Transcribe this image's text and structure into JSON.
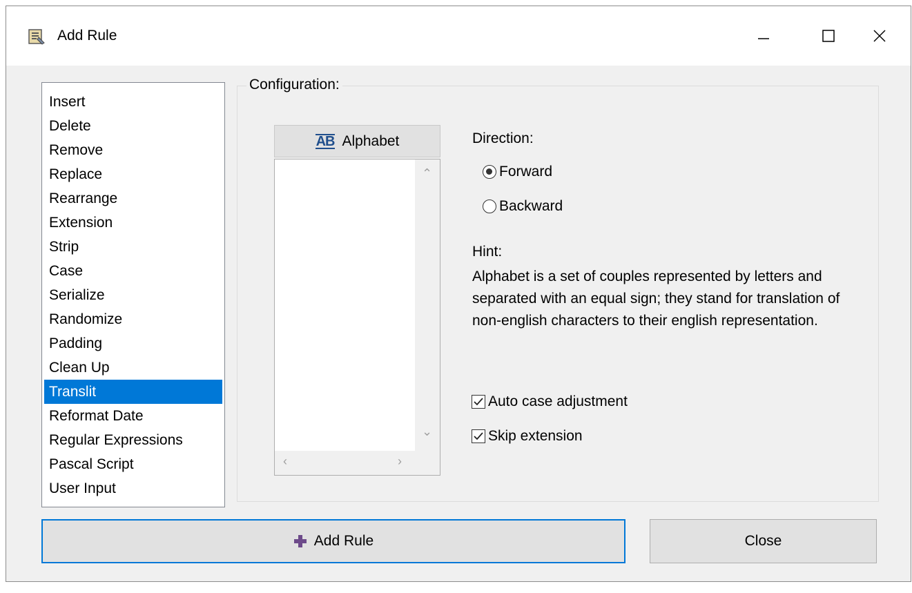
{
  "window": {
    "title": "Add Rule",
    "icon": "add-rule-app-icon",
    "controls": [
      "minimize-icon",
      "maximize-icon",
      "close-icon"
    ]
  },
  "rules": {
    "items": [
      "Insert",
      "Delete",
      "Remove",
      "Replace",
      "Rearrange",
      "Extension",
      "Strip",
      "Case",
      "Serialize",
      "Randomize",
      "Padding",
      "Clean Up",
      "Translit",
      "Reformat Date",
      "Regular Expressions",
      "Pascal Script",
      "User Input"
    ],
    "selected": "Translit"
  },
  "configuration": {
    "label": "Configuration:",
    "alphabet_button": "Alphabet",
    "alphabet_icon_text": "AB",
    "direction": {
      "label": "Direction:",
      "forward": "Forward",
      "backward": "Backward",
      "selected": "Forward"
    },
    "hint": {
      "label": "Hint:",
      "text": "Alphabet is a set of couples represented by letters and separated with an equal sign; they stand for translation of non-english characters to their english representation."
    },
    "auto_case": {
      "label": "Auto case adjustment",
      "checked": true
    },
    "skip_extension": {
      "label": "Skip extension",
      "checked": true
    }
  },
  "buttons": {
    "add_rule": "Add Rule",
    "close": "Close"
  },
  "colors": {
    "selection": "#0078d7",
    "add_icon": "#6d4a8a"
  }
}
